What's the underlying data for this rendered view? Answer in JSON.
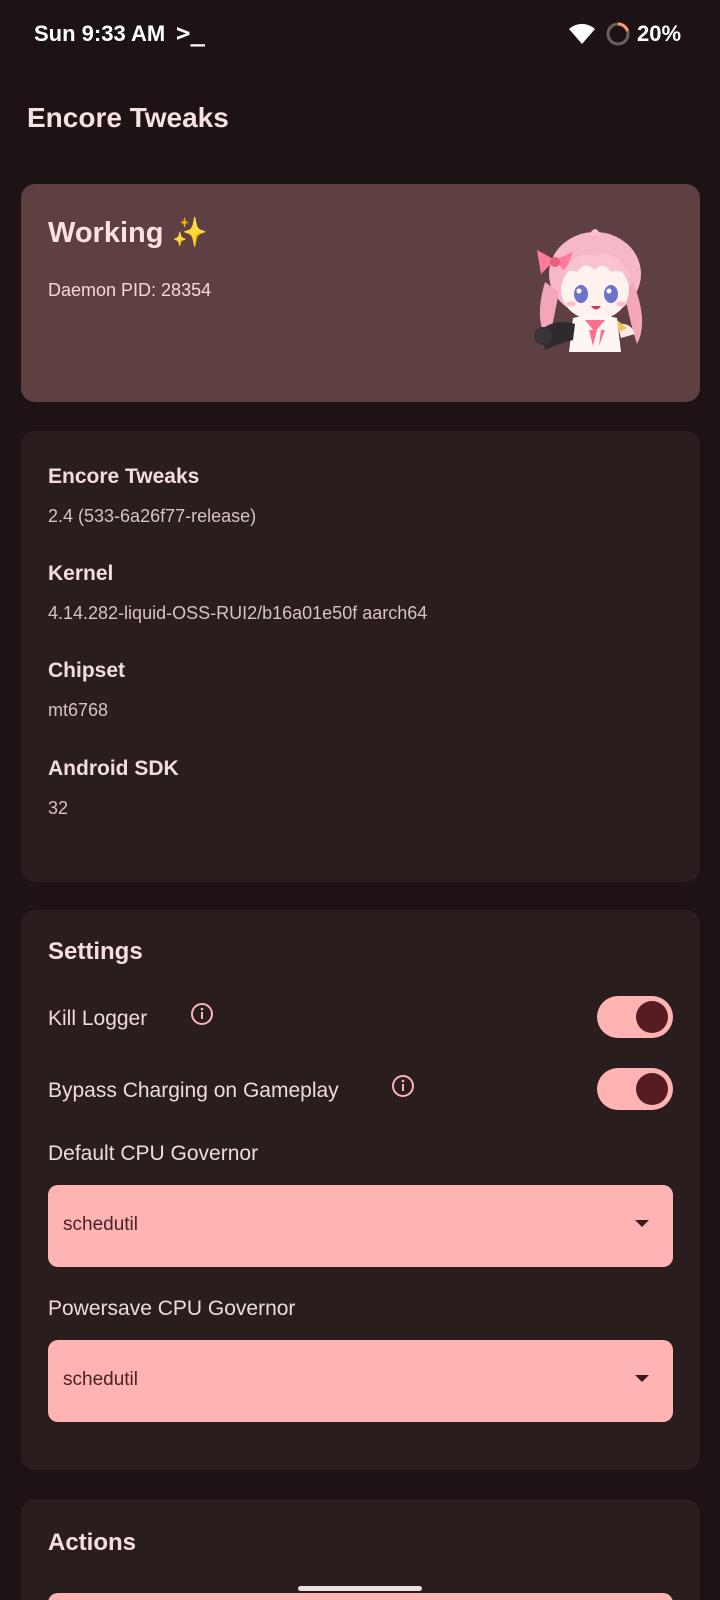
{
  "status_bar": {
    "time": "Sun 9:33 AM",
    "terminal_glyph": ">_",
    "battery_percent": "20%",
    "battery_level": 0.2
  },
  "app": {
    "title": "Encore Tweaks"
  },
  "status_card": {
    "title": "Working ✨",
    "daemon_pid": "Daemon PID: 28354"
  },
  "info": {
    "items": [
      {
        "label": "Encore Tweaks",
        "value": "2.4 (533-6a26f77-release)"
      },
      {
        "label": "Kernel",
        "value": "4.14.282-liquid-OSS-RUI2/b16a01e50f aarch64"
      },
      {
        "label": "Chipset",
        "value": "mt6768"
      },
      {
        "label": "Android SDK",
        "value": "32"
      }
    ]
  },
  "settings": {
    "title": "Settings",
    "kill_logger": {
      "label": "Kill Logger",
      "enabled": true
    },
    "bypass_charging": {
      "label": "Bypass Charging on Gameplay",
      "enabled": true
    },
    "default_cpu_governor": {
      "label": "Default CPU Governor",
      "value": "schedutil"
    },
    "powersave_cpu_governor": {
      "label": "Powersave CPU Governor",
      "value": "schedutil"
    }
  },
  "actions": {
    "title": "Actions"
  },
  "colors": {
    "background": "#1d1314",
    "card": "#2a1d1e",
    "status_card": "#5e3f42",
    "accent": "#ffb3b3",
    "switch_thumb": "#561c22"
  }
}
